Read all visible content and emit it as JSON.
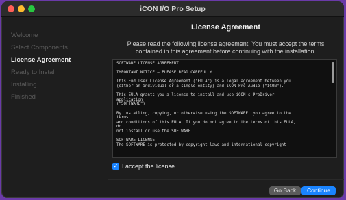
{
  "window": {
    "title": "iCON I/O Pro Setup"
  },
  "sidebar": {
    "steps": [
      {
        "label": "Welcome"
      },
      {
        "label": "Select Components"
      },
      {
        "label": "License Agreement"
      },
      {
        "label": "Ready to Install"
      },
      {
        "label": "Installing"
      },
      {
        "label": "Finished"
      }
    ],
    "active_step": "License Agreement"
  },
  "main": {
    "title": "License Agreement",
    "intro": "Please read the following license agreement. You must accept the terms contained in this agreement before continuing with the installation.",
    "license_text": "SOFTWARE LICENSE AGREEMENT\n\nIMPORTANT NOTICE – PLEASE READ CAREFULLY\n\nThis End User License Agreement (\"EULA\") is a legal agreement between you\n(either an individual or a single entity) and iCON Pro Audio (\"iCON\").\n\nThis EULA grants you a license to install and use iCON's ProDriver\napplication\n(\"SOFTWARE\")\n\nBy installing, copying, or otherwise using the SOFTWARE, you agree to the\nterms\nand conditions of this EULA. If you do not agree to the terms of this EULA,\ndo\nnot install or use the SOFTWARE.\n\nSOFTWARE LICENSE\nThe SOFTWARE is protected by copyright laws and international copyright",
    "accept_label": "I accept the license.",
    "accept_checked": true
  },
  "footer": {
    "back_label": "Go Back",
    "continue_label": "Continue"
  },
  "colors": {
    "accent": "#1a84ff",
    "background": "#1e1e1e"
  }
}
